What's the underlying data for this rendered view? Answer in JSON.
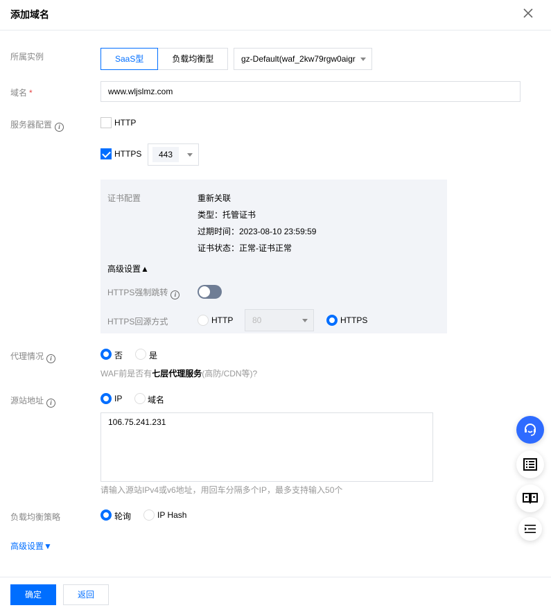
{
  "dialog": {
    "title": "添加域名",
    "close_icon": "close-icon"
  },
  "form": {
    "instance": {
      "label": "所属实例",
      "types": [
        {
          "label": "SaaS型",
          "active": true
        },
        {
          "label": "负载均衡型",
          "active": false
        }
      ],
      "selected": "gz-Default(waf_2kw79rgw0aigr"
    },
    "domain": {
      "label": "域名",
      "required_mark": "*",
      "value": "www.wljslmz.com"
    },
    "server_config": {
      "label": "服务器配置",
      "http": {
        "label": "HTTP",
        "checked": false
      },
      "https": {
        "label": "HTTPS",
        "checked": true,
        "port": "443"
      }
    },
    "cert": {
      "label": "证书配置",
      "relink": "重新关联",
      "type": "类型：托管证书",
      "expire": "过期时间：2023-08-10 23:59:59",
      "status": "证书状态：正常-证书正常",
      "advanced_toggle": "高级设置▲",
      "force_redirect_label": "HTTPS强制跳转",
      "force_redirect_on": false,
      "origin_method_label": "HTTPS回源方式",
      "origin_http_label": "HTTP",
      "origin_http_port": "80",
      "origin_https_label": "HTTPS",
      "origin_selected": "HTTPS"
    },
    "proxy": {
      "label": "代理情况",
      "options": [
        {
          "label": "否",
          "selected": true
        },
        {
          "label": "是",
          "selected": false
        }
      ],
      "hint_prefix": "WAF前是否有",
      "hint_bold": "七层代理服务",
      "hint_suffix": "(高防/CDN等)?"
    },
    "origin": {
      "label": "源站地址",
      "options": [
        {
          "label": "IP",
          "selected": true
        },
        {
          "label": "域名",
          "selected": false
        }
      ],
      "value": "106.75.241.231",
      "hint": "请输入源站IPv4或v6地址，用回车分隔多个IP，最多支持输入50个"
    },
    "lb_strategy": {
      "label": "负载均衡策略",
      "options": [
        {
          "label": "轮询",
          "selected": true
        },
        {
          "label": "IP Hash",
          "selected": false
        }
      ]
    },
    "advanced_toggle": "高级设置▼"
  },
  "footer": {
    "confirm": "确定",
    "back": "返回"
  },
  "floating": [
    {
      "icon": "headset-icon"
    },
    {
      "icon": "list-icon"
    },
    {
      "icon": "book-icon"
    },
    {
      "icon": "indent-icon"
    }
  ],
  "colors": {
    "primary": "#006eff",
    "panel_bg": "#f2f4f8",
    "label": "#888888"
  }
}
